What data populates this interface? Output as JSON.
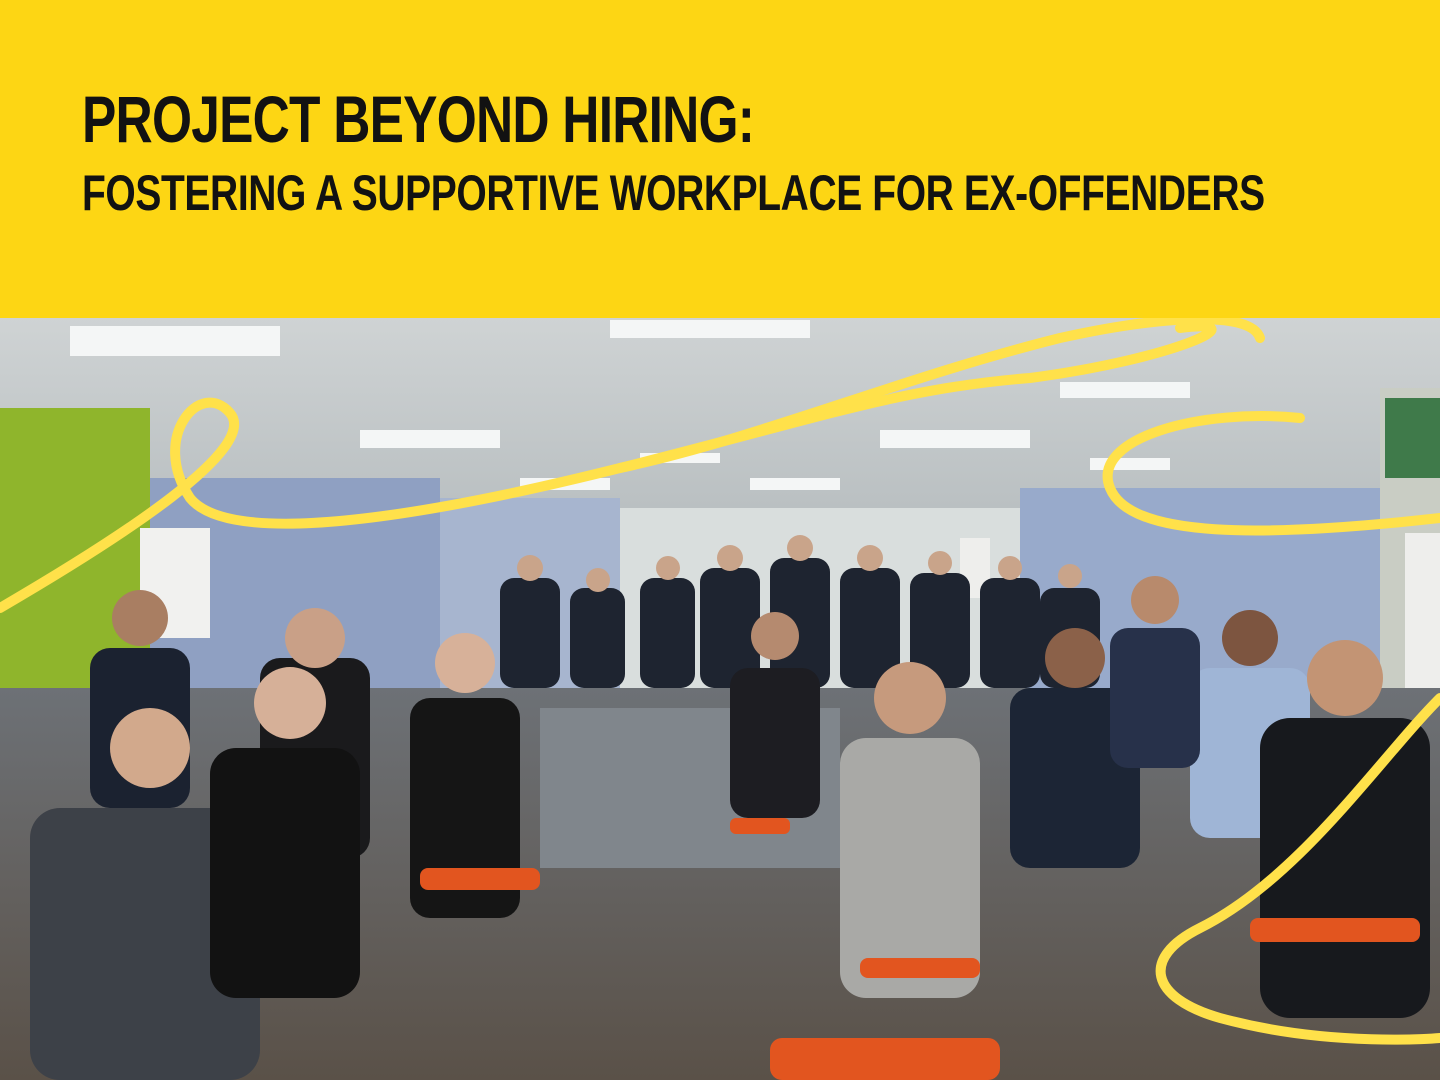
{
  "banner": {
    "title_line1": "PROJECT BEYOND HIRING:",
    "title_line2": "FOSTERING A SUPPORTIVE WORKPLACE FOR EX-OFFENDERS"
  },
  "photo": {
    "subject": "group-photo-of-attendees-seated-in-training-room"
  },
  "colors": {
    "brand_yellow": "#FDD614",
    "headline_text": "#121212",
    "ribbon": "#FFE14A"
  }
}
